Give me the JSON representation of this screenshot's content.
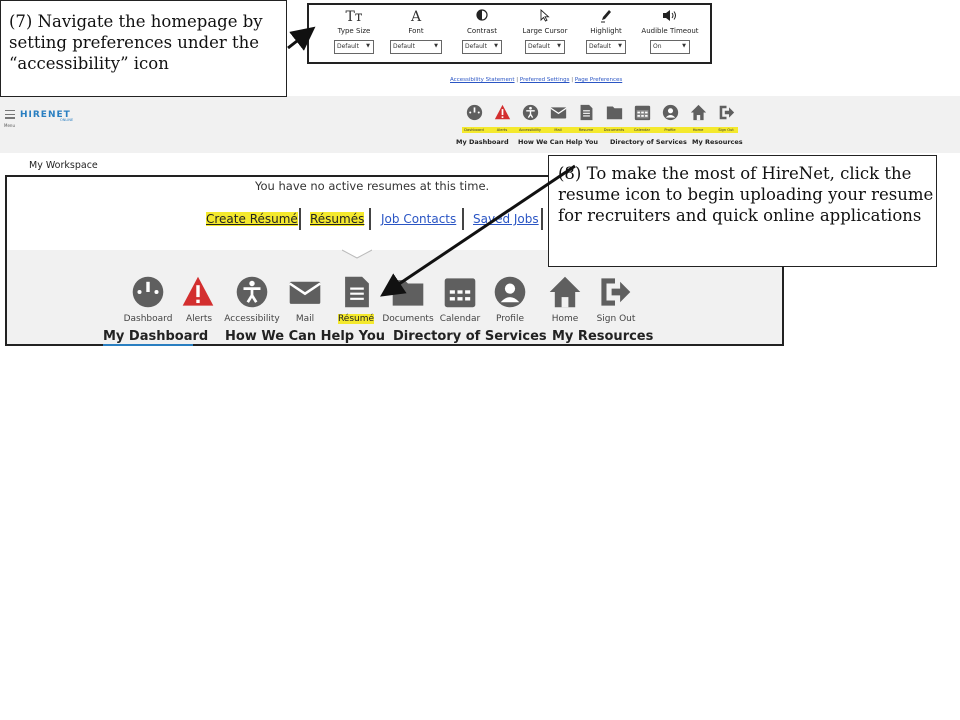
{
  "callouts": {
    "step7": "(7) Navigate the homepage by setting preferences under the “accessibility” icon",
    "step8": "(8) To make the most of HireNet, click the resume icon to begin uploading your resume for recruiters and quick online applications"
  },
  "prefs": {
    "items": [
      {
        "icon": "Tт",
        "label": "Type Size",
        "value": "Default"
      },
      {
        "icon": "A",
        "label": "Font",
        "value": "Default"
      },
      {
        "icon": "◐",
        "label": "Contrast",
        "value": "Default"
      },
      {
        "icon": "cursor",
        "label": "Large Cursor",
        "value": "Default"
      },
      {
        "icon": "pen",
        "label": "Highlight",
        "value": "Default"
      },
      {
        "icon": "speaker",
        "label": "Audible Timeout",
        "value": "On"
      }
    ],
    "links": [
      "Accessibility Statement",
      "Preferred Settings",
      "Page Preferences"
    ]
  },
  "header": {
    "menu_label": "Menu",
    "logo": "HIRENET",
    "logo_sub": "ONLINE",
    "nav": [
      "Dashboard",
      "Alerts",
      "Accessibility",
      "Mail",
      "Resume",
      "Documents",
      "Calendar",
      "Profile",
      "Home",
      "Sign Out"
    ],
    "categories": [
      "My Dashboard",
      "How We Can Help You",
      "Directory of Services",
      "My Resources"
    ]
  },
  "workspace": {
    "title": "My Workspace",
    "no_resumes": "You have no active resumes at this time.",
    "links": [
      "Create Résumé",
      "Résumés",
      "Job Contacts",
      "Saved Jobs"
    ],
    "nav": [
      "Dashboard",
      "Alerts",
      "Accessibility",
      "Mail",
      "Résumé",
      "Documents",
      "Calendar",
      "Profile",
      "Home",
      "Sign Out"
    ],
    "categories": [
      "My Dashboard",
      "How We Can Help You",
      "Directory of Services",
      "My Resources"
    ]
  },
  "colors": {
    "highlight": "#f4e92d",
    "link": "#2a55c4",
    "alert": "#d32f2f",
    "icon": "#5f5f5f"
  }
}
